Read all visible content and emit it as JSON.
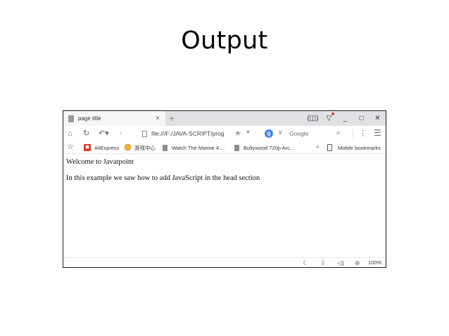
{
  "slide": {
    "title": "Output"
  },
  "browser": {
    "tab": {
      "title": "page title",
      "close_glyph": "×",
      "new_tab_glyph": "+"
    },
    "window_controls": {
      "reader_glyph": "(◫)",
      "shield_glyph": "▽",
      "minimize_glyph": "_",
      "maximize_glyph": "□",
      "close_glyph": "✕"
    },
    "nav": {
      "home_glyph": "⌂",
      "reload_glyph": "↻",
      "undo_glyph": "↶▾",
      "back_glyph": "‹",
      "address": "file:///F:/JAVA-SCRIPT/prog",
      "star_glyph": "★",
      "dropdown_glyph": "▼",
      "search_engine_badge": "g",
      "search_caret": "∨",
      "search_placeholder": "Google",
      "search_glyph": "⌕",
      "more_glyph": "⋮",
      "menu_glyph": "☰"
    },
    "bookmarks": {
      "star_glyph": "☆",
      "items": [
        {
          "label": "AliExpress",
          "icon": "aliexpress-icon"
        },
        {
          "label": "游戏中心",
          "icon": "game-center-icon"
        },
        {
          "label": "Watch The Marine 4:...",
          "icon": "folder-icon"
        },
        {
          "label": "Bollywood 720p Arc...",
          "icon": "folder-icon"
        }
      ],
      "overflow_glyph": "»",
      "mobile_label": "Mobile bookmarks"
    },
    "page": {
      "lines": [
        "Welcome to Javatpoint",
        "In this example we saw how to add JavaScript in the head section"
      ]
    },
    "status": {
      "night_glyph": "☾",
      "download_glyph": "⇩",
      "sound_glyph": "◁)",
      "zoom_glyph": "⊕",
      "zoom_level": "100%"
    },
    "colors": {
      "tab_strip": "#dfe1e5",
      "badge_blue": "#4285f4",
      "aliexpress_red": "#e43225",
      "notification_red": "#e53935"
    }
  }
}
